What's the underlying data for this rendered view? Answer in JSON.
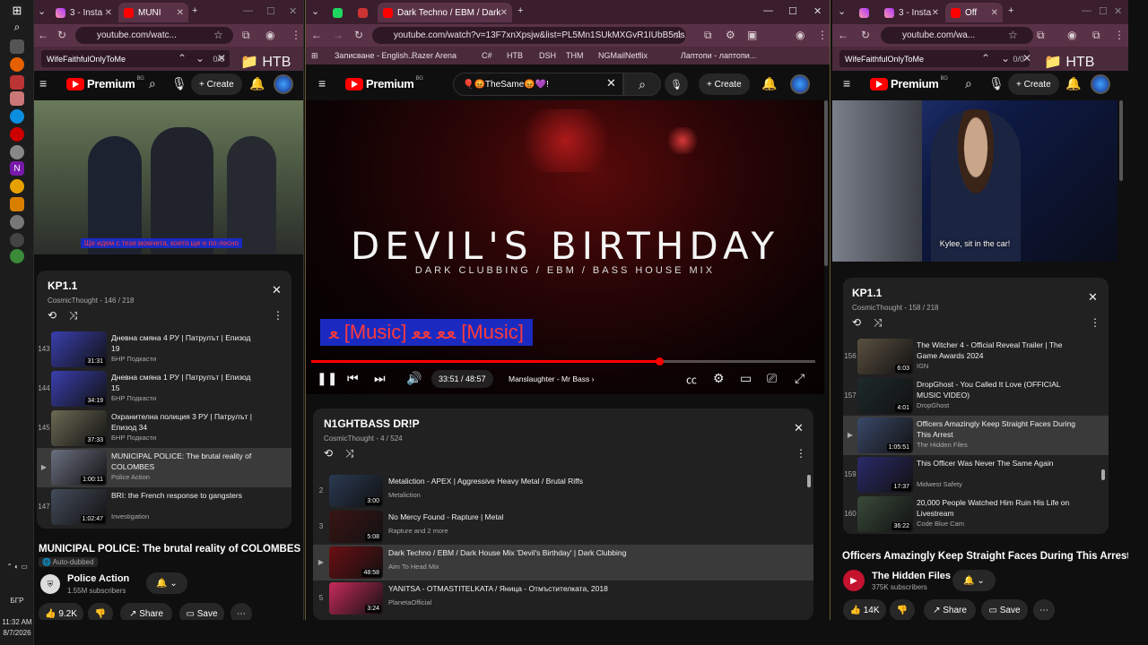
{
  "taskbar": {
    "time": "11:32 AM",
    "date": "8/7/2026",
    "lang": "БГР",
    "icons": [
      "windows-start-icon",
      "search-icon",
      "edge-icon",
      "chrome-icon",
      "app-icon"
    ]
  },
  "left": {
    "tabs": [
      {
        "label": "3 - Insta"
      },
      {
        "label": "MUNI"
      }
    ],
    "url": "youtube.com/watc...",
    "find_text": "WifeFaithfulOnlyToMe",
    "find_count": "0/0",
    "bookmark": "HTB",
    "logo": "Premium",
    "logo_region": "BG",
    "create": "Create",
    "subtitle_overlay": "Ще идем с тези момчета, което ще е по-лесно",
    "playlist": {
      "title": "KP1.1",
      "sub": "CosmicThought - 146 / 218",
      "items": [
        {
          "num": "143",
          "title": "Дневна смяна 4 РУ | Патрулът | Епизод 19",
          "channel": "БНР Подкасти",
          "duration": "31:31"
        },
        {
          "num": "144",
          "title": "Дневна смяна 1 РУ | Патрулът | Епизод 15",
          "channel": "БНР Подкасти",
          "duration": "34:19"
        },
        {
          "num": "145",
          "title": "Охранителна полиция 3 РУ | Патрулът | Епизод 34",
          "channel": "БНР Подкасти",
          "duration": "37:33"
        },
        {
          "num": "▶",
          "title": "MUNICIPAL POLICE: The brutal reality of COLOMBES",
          "channel": "Police Action",
          "duration": "1:00:11"
        },
        {
          "num": "147",
          "title": "BRI: the French response to gangsters",
          "channel": "Investigation",
          "duration": "1:02:47"
        }
      ]
    },
    "video_title": "MUNICIPAL POLICE: The brutal reality of COLOMBES",
    "badge": "Auto-dubbed",
    "channel": "Police Action",
    "subs": "1.55M subscribers",
    "likes": "9.2K",
    "share": "Share",
    "save": "Save"
  },
  "mid": {
    "tabs": [
      {
        "label": "Dark Techno / EBM / Dark"
      }
    ],
    "url": "youtube.com/watch?v=13F7xnXpsjw&list=PL5Mn1SUkMXGvR1IUbB5nls...",
    "bookmarks": [
      "Записване - English...",
      "Razer Arena",
      "C#",
      "HTB",
      "DSH",
      "THM",
      "NGMail",
      "Netflix",
      "Лаптопи - лаптопи..."
    ],
    "logo": "Premium",
    "logo_region": "BG",
    "search_value": "🎈😡TheSame😡💜!",
    "create": "Create",
    "video_heading": "DEVIL'S BIRTHDAY",
    "video_subheading": "DARK CLUBBING / EBM / BASS HOUSE MIX",
    "caption": "ﻌ [Music] ﻌﻌ ﻌﻌ [Music]",
    "time_current": "33:51",
    "time_total": "48:57",
    "chapter": "Manslaughter - Mr Bass",
    "progress": 0.69,
    "playlist": {
      "title": "N1GHTBASS DR!P",
      "sub": "CosmicThought - 4 / 524",
      "items": [
        {
          "num": "2",
          "title": "Metaliction - APEX | Aggressive Heavy Metal / Brutal Riffs",
          "channel": "Metaliction",
          "duration": "3:00"
        },
        {
          "num": "3",
          "title": "No Mercy Found - Rapture | Metal",
          "channel": "Rapture and 2 more",
          "duration": "5:08"
        },
        {
          "num": "▶",
          "title": "Dark Techno / EBM / Dark House Mix 'Devil's Birthday' | Dark Clubbing",
          "channel": "Aim To Head Mix",
          "duration": "48:58"
        },
        {
          "num": "5",
          "title": "YANITSA - OTMASTITELKATA / Яница - Отмъстителката, 2018",
          "channel": "PlanetaOfficial",
          "duration": "3:24"
        }
      ]
    }
  },
  "right": {
    "tabs": [
      {
        "label": "3 - Insta"
      },
      {
        "label": "Off"
      }
    ],
    "url": "youtube.com/wa...",
    "find_text": "WifeFaithfulOnlyToMe",
    "find_count": "0/0",
    "bookmark": "HTB",
    "logo": "Premium",
    "logo_region": "BG",
    "create": "Create",
    "subtitle_overlay": "Kylee, sit in the car!",
    "playlist": {
      "title": "KP1.1",
      "sub": "CosmicThought - 158 / 218",
      "items": [
        {
          "num": "156",
          "title": "The Witcher 4 - Official Reveal Trailer | The Game Awards 2024",
          "channel": "IGN",
          "duration": "6:03"
        },
        {
          "num": "157",
          "title": "DropGhost - You Called It Love (OFFICIAL MUSIC VIDEO)",
          "channel": "DropGhost",
          "duration": "4:01"
        },
        {
          "num": "▶",
          "title": "Officers Amazingly Keep Straight Faces During This Arrest",
          "channel": "The Hidden Files",
          "duration": "1:05:51"
        },
        {
          "num": "159",
          "title": "This Officer Was Never The Same Again",
          "channel": "Midwest Safety",
          "duration": "17:37"
        },
        {
          "num": "160",
          "title": "20,000 People Watched Him Ruin His Life on Livestream",
          "channel": "Code Blue Cam",
          "duration": "36:22"
        }
      ]
    },
    "video_title": "Officers Amazingly Keep Straight Faces During This Arrest",
    "channel": "The Hidden Files",
    "subs": "375K subscribers",
    "likes": "14K",
    "share": "Share",
    "save": "Save"
  }
}
